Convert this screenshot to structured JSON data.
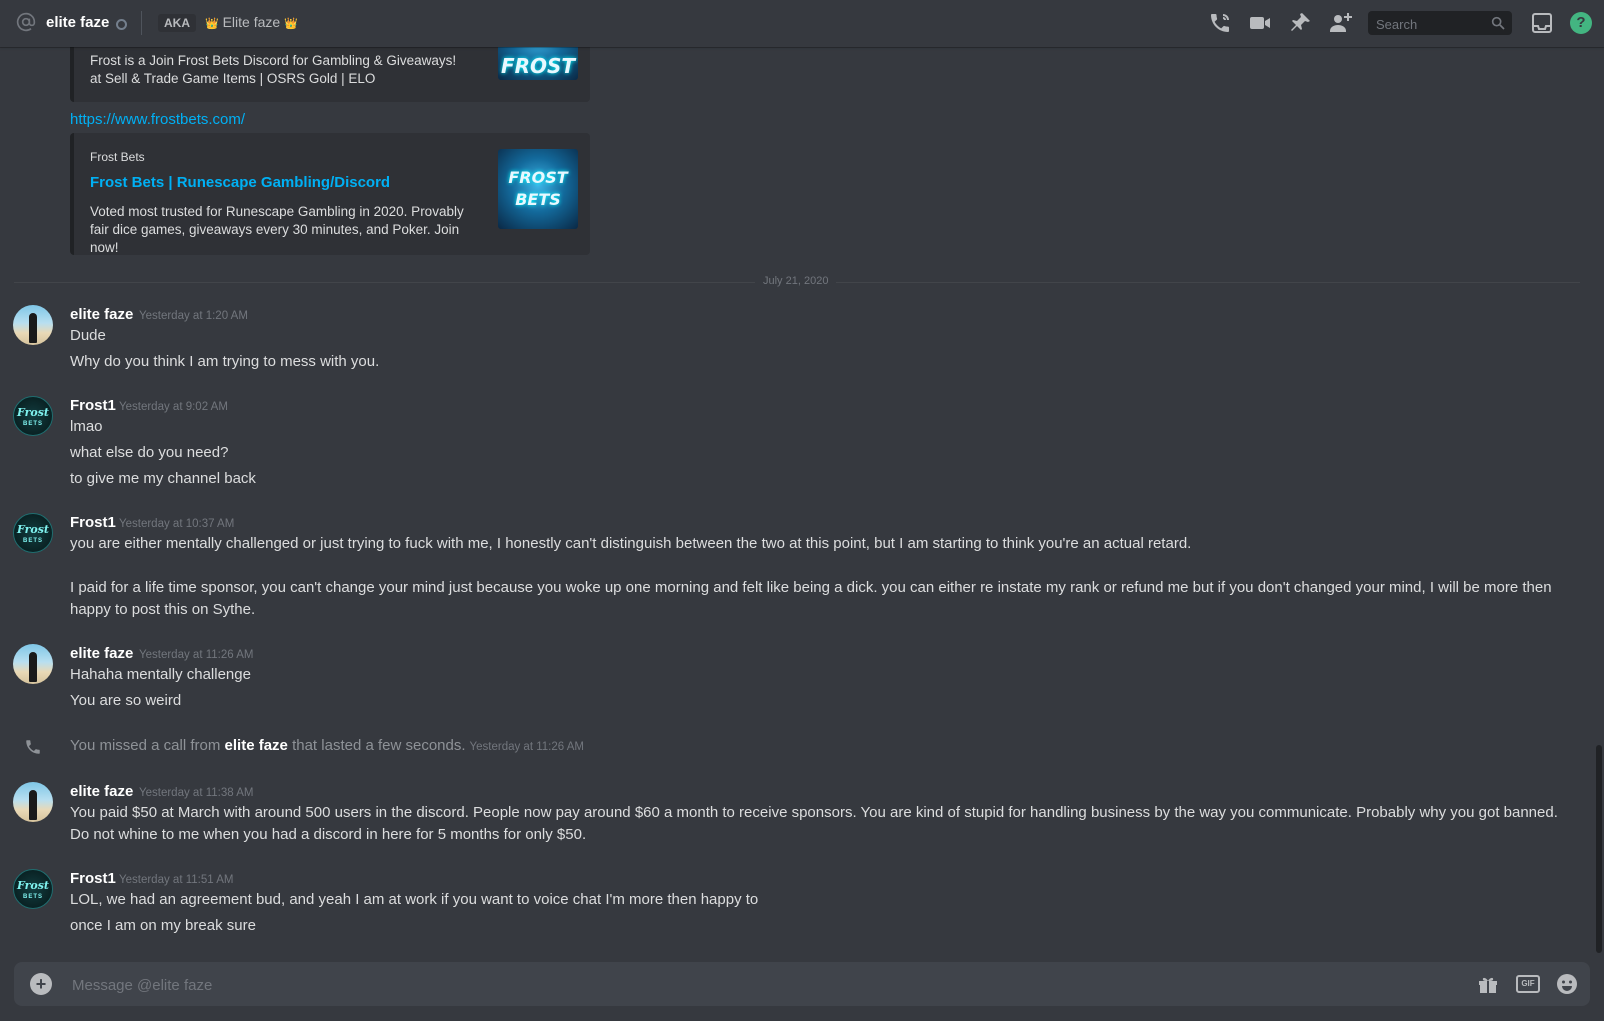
{
  "header": {
    "recipient": "elite faze",
    "aka_label": "AKA",
    "nickname": "Elite faze",
    "crown": "👑",
    "search_placeholder": "Search",
    "help_glyph": "?"
  },
  "embeds": [
    {
      "description": "Frost is a Join Frost Bets Discord for Gambling & Giveaways! at Sell & Trade Game Items | OSRS Gold | ELO",
      "thumb_text": "FROST"
    },
    {
      "provider": "Frost Bets",
      "title": "Frost Bets | Runescape Gambling/Discord",
      "description": "Voted most trusted for Runescape Gambling in 2020. Provably fair dice games, giveaways every 30 minutes, and Poker. Join now!",
      "thumb_text": "FROST BETS"
    }
  ],
  "link_url": "https://www.frostbets.com/",
  "date_divider": "July 21, 2020",
  "messages": [
    {
      "author": "elite faze",
      "timestamp": "Yesterday at 1:20 AM",
      "lines": [
        "Dude",
        "Why do you think I am trying to mess with you."
      ]
    },
    {
      "author": "Frost1",
      "timestamp": "Yesterday at 9:02 AM",
      "lines": [
        "lmao",
        "what else do you need?",
        "to give me my channel back"
      ]
    },
    {
      "author": "Frost1",
      "timestamp": "Yesterday at 10:37 AM",
      "lines": [
        "you are either mentally challenged or just trying to fuck with me, I honestly can't distinguish between the two at this point, but I am starting to think you're an actual retard.",
        "I paid for a life time sponsor, you can't change your mind just because you woke up one morning and felt like being a dick. you can either re instate my rank or refund me but if you don't  changed your mind, I will be more then happy to post this on Sythe."
      ]
    },
    {
      "author": "elite faze",
      "timestamp": "Yesterday at 11:26 AM",
      "lines": [
        "Hahaha mentally challenge",
        "You are so weird"
      ]
    },
    {
      "author": "elite faze",
      "timestamp": "Yesterday at 11:38 AM",
      "lines": [
        "You paid $50 at March with around 500 users in the discord. People now pay around $60 a month to receive sponsors.  You are kind of stupid for handling business by the way you communicate. Probably why you got banned. Do not whine to me when you had a discord in here for 5 months for only $50."
      ]
    },
    {
      "author": "Frost1",
      "timestamp": "Yesterday at 11:51 AM",
      "lines": [
        "LOL, we had an agreement bud, and yeah I am at work if you want to voice chat I'm more then happy to",
        "once I am on my break sure"
      ]
    }
  ],
  "system_call": {
    "prefix": "You missed a call from",
    "caller": "elite faze",
    "suffix": "that lasted a few seconds.",
    "timestamp": "Yesterday at 11:26 AM"
  },
  "composer": {
    "placeholder": "Message @elite faze",
    "plus_glyph": "+",
    "gif_label": "GIF"
  },
  "avatar_text": {
    "frost_main": "Frost",
    "frost_sub": "BETS"
  },
  "colors": {
    "background": "#36393f",
    "link": "#00b0f4",
    "online_help": "#43b581"
  }
}
